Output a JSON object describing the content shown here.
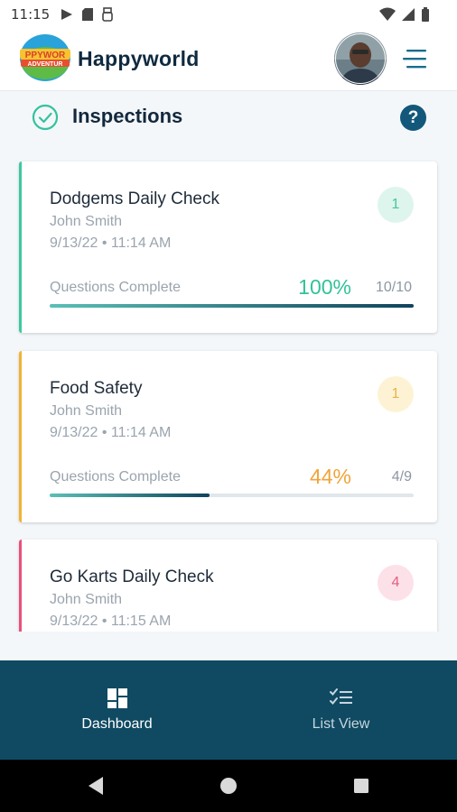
{
  "status_bar": {
    "time": "11:15",
    "left_icons": [
      "play-protect-icon",
      "sd-card-icon",
      "usb-icon"
    ],
    "right_icons": [
      "wifi-icon",
      "signal-icon",
      "battery-icon"
    ]
  },
  "header": {
    "logo_text": "HAPPYWORLD ADVENTURE",
    "app_name": "Happyworld",
    "avatar": "user-avatar",
    "menu_icon": "hamburger-menu-icon"
  },
  "section": {
    "title": "Inspections",
    "icon": "check-circle-icon",
    "help_label": "?"
  },
  "cards": [
    {
      "title": "Dodgems Daily Check",
      "author": "John Smith",
      "date": "9/13/22 • 11:14 AM",
      "badge": "1",
      "progress_label": "Questions Complete",
      "percent_text": "100%",
      "count_text": "10/10",
      "progress": 1.0,
      "accent_color": "#3cc9a2",
      "percent_color": "#31c29a",
      "badge_bg": "#def5ee",
      "badge_color": "#46c59f"
    },
    {
      "title": "Food Safety",
      "author": "John Smith",
      "date": "9/13/22 • 11:14 AM",
      "badge": "1",
      "progress_label": "Questions Complete",
      "percent_text": "44%",
      "count_text": "4/9",
      "progress": 0.44,
      "accent_color": "#f2b233",
      "percent_color": "#f0a43a",
      "badge_bg": "#fdf3d4",
      "badge_color": "#e9b24a"
    },
    {
      "title": "Go Karts Daily Check",
      "author": "John Smith",
      "date": "9/13/22 • 11:15 AM",
      "badge": "4",
      "progress_label": "",
      "percent_text": "",
      "count_text": "",
      "progress": null,
      "accent_color": "#e8517a",
      "percent_color": "#e8517a",
      "badge_bg": "#fde1e8",
      "badge_color": "#e35f81"
    }
  ],
  "bottom_nav": {
    "items": [
      {
        "label": "Dashboard",
        "icon": "dashboard-grid-icon",
        "active": true
      },
      {
        "label": "List View",
        "icon": "checklist-icon",
        "active": false
      }
    ]
  },
  "system_nav": [
    "back-icon",
    "home-icon",
    "recents-icon"
  ]
}
